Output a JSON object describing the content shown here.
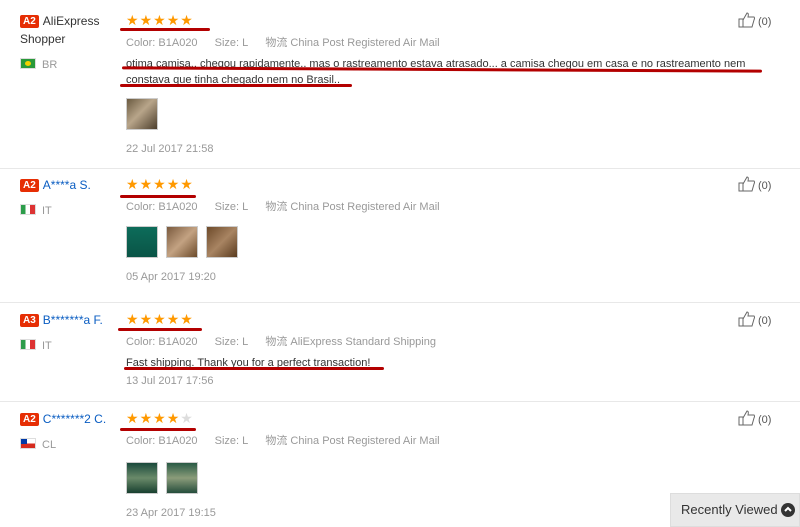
{
  "reviews": [
    {
      "badge": "A2",
      "user": "AliExpress Shopper",
      "country": "BR",
      "flag": "br",
      "rating": 5,
      "color_label": "Color:",
      "color": "B1A020",
      "size_label": "Size:",
      "size": "L",
      "ship_label": "物流",
      "shipping": "China Post Registered Air Mail",
      "comment": "otima camisa.. chegou rapidamente.. mas o rastreamento estava atrasado... a camisa chegou em casa e no rastreamento nem constava que tinha chegado nem no Brasil..",
      "photos": [
        "t1"
      ],
      "date": "22 Jul 2017 21:58",
      "likes": "(0)"
    },
    {
      "badge": "A2",
      "user": "A****a S.",
      "country": "IT",
      "flag": "it",
      "rating": 5,
      "color_label": "Color:",
      "color": "B1A020",
      "size_label": "Size:",
      "size": "L",
      "ship_label": "物流",
      "shipping": "China Post Registered Air Mail",
      "comment": "",
      "photos": [
        "t2",
        "t3",
        "t4"
      ],
      "date": "05 Apr 2017 19:20",
      "likes": "(0)"
    },
    {
      "badge": "A3",
      "user": "B*******a F.",
      "country": "IT",
      "flag": "it",
      "rating": 5,
      "color_label": "Color:",
      "color": "B1A020",
      "size_label": "Size:",
      "size": "L",
      "ship_label": "物流",
      "shipping": "AliExpress Standard Shipping",
      "comment": "Fast shipping. Thank you for a perfect transaction!",
      "photos": [],
      "date": "13 Jul 2017 17:56",
      "likes": "(0)"
    },
    {
      "badge": "A2",
      "user": "C*******2 C.",
      "country": "CL",
      "flag": "cl",
      "rating": 4,
      "color_label": "Color:",
      "color": "B1A020",
      "size_label": "Size:",
      "size": "L",
      "ship_label": "物流",
      "shipping": "China Post Registered Air Mail",
      "comment": "",
      "photos": [
        "t5",
        "t6"
      ],
      "date": "23 Apr 2017 19:15",
      "likes": "(0)"
    }
  ],
  "recently_viewed": "Recently Viewed",
  "colors": {
    "badge": "#e62e04",
    "star": "#ff9900",
    "link": "#0a5dc2",
    "underline": "#b30000"
  }
}
